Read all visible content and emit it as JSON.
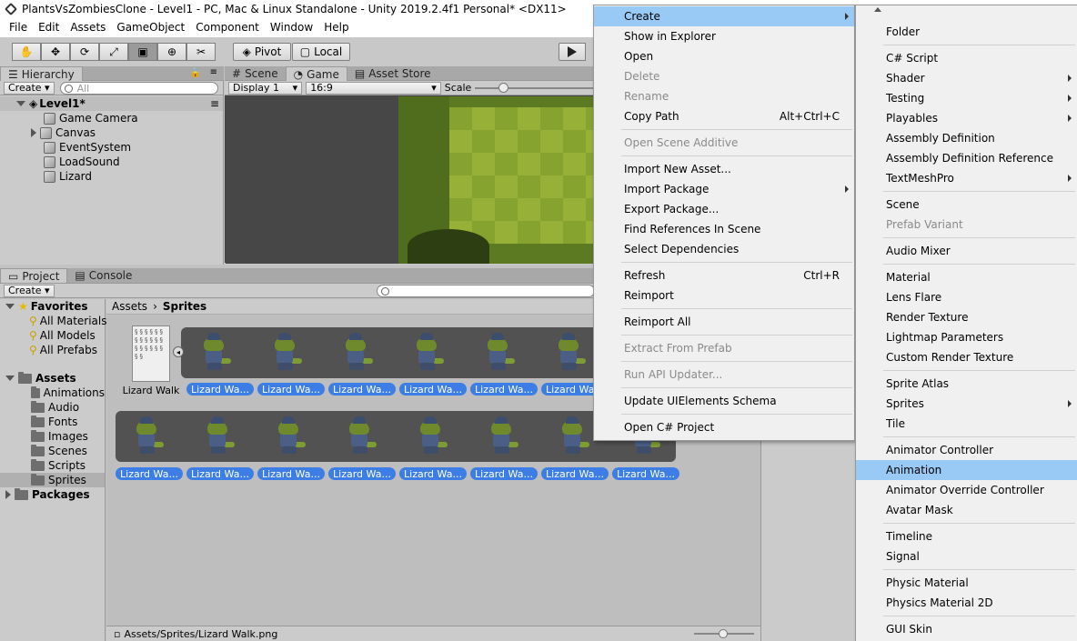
{
  "window": {
    "title": "PlantsVsZombiesClone - Level1 - PC, Mac & Linux Standalone - Unity 2019.2.4f1 Personal* <DX11>"
  },
  "menubar": [
    "File",
    "Edit",
    "Assets",
    "GameObject",
    "Component",
    "Window",
    "Help"
  ],
  "toolbar": {
    "pivot": "Pivot",
    "local": "Local"
  },
  "hierarchy": {
    "tab": "Hierarchy",
    "create": "Create",
    "search_placeholder": "All",
    "scene": "Level1*",
    "items": [
      "Game Camera",
      "Canvas",
      "EventSystem",
      "LoadSound",
      "Lizard"
    ]
  },
  "game": {
    "tabs": [
      "Scene",
      "Game",
      "Asset Store"
    ],
    "display": "Display 1",
    "aspect": "16:9",
    "scale": "Scale"
  },
  "project": {
    "tabs": [
      "Project",
      "Console"
    ],
    "create": "Create",
    "favorites": {
      "label": "Favorites",
      "items": [
        "All Materials",
        "All Models",
        "All Prefabs"
      ]
    },
    "assets": {
      "label": "Assets",
      "items": [
        "Animations",
        "Audio",
        "Fonts",
        "Images",
        "Scenes",
        "Scripts",
        "Sprites"
      ]
    },
    "packages": "Packages",
    "breadcrumb": [
      "Assets",
      "Sprites"
    ],
    "sheet_name": "Lizard Walk",
    "sprite_label": "Lizard Wa...",
    "status_path": "Assets/Sprites/Lizard Walk.png"
  },
  "context_menu": {
    "items": [
      {
        "label": "Create",
        "highlight": true,
        "submenu": true
      },
      {
        "label": "Show in Explorer"
      },
      {
        "label": "Open"
      },
      {
        "label": "Delete",
        "disabled": true
      },
      {
        "label": "Rename",
        "disabled": true
      },
      {
        "label": "Copy Path",
        "shortcut": "Alt+Ctrl+C"
      },
      {
        "label": "Open Scene Additive",
        "disabled": true
      },
      {
        "label": "Import New Asset..."
      },
      {
        "label": "Import Package",
        "submenu": true
      },
      {
        "label": "Export Package..."
      },
      {
        "label": "Find References In Scene"
      },
      {
        "label": "Select Dependencies"
      },
      {
        "label": "Refresh",
        "shortcut": "Ctrl+R"
      },
      {
        "label": "Reimport"
      },
      {
        "label": "Reimport All"
      },
      {
        "label": "Extract From Prefab",
        "disabled": true
      },
      {
        "label": "Run API Updater...",
        "disabled": true
      },
      {
        "label": "Update UIElements Schema"
      },
      {
        "label": "Open C# Project"
      }
    ]
  },
  "create_submenu": {
    "items": [
      {
        "label": "Folder"
      },
      {
        "label": "C# Script"
      },
      {
        "label": "Shader",
        "submenu": true
      },
      {
        "label": "Testing",
        "submenu": true
      },
      {
        "label": "Playables",
        "submenu": true
      },
      {
        "label": "Assembly Definition"
      },
      {
        "label": "Assembly Definition Reference"
      },
      {
        "label": "TextMeshPro",
        "submenu": true
      },
      {
        "label": "Scene"
      },
      {
        "label": "Prefab Variant",
        "disabled": true
      },
      {
        "label": "Audio Mixer"
      },
      {
        "label": "Material"
      },
      {
        "label": "Lens Flare"
      },
      {
        "label": "Render Texture"
      },
      {
        "label": "Lightmap Parameters"
      },
      {
        "label": "Custom Render Texture"
      },
      {
        "label": "Sprite Atlas"
      },
      {
        "label": "Sprites",
        "submenu": true
      },
      {
        "label": "Tile"
      },
      {
        "label": "Animator Controller"
      },
      {
        "label": "Animation",
        "highlight": true
      },
      {
        "label": "Animator Override Controller"
      },
      {
        "label": "Avatar Mask"
      },
      {
        "label": "Timeline"
      },
      {
        "label": "Signal"
      },
      {
        "label": "Physic Material"
      },
      {
        "label": "Physics Material 2D"
      },
      {
        "label": "GUI Skin"
      }
    ]
  }
}
